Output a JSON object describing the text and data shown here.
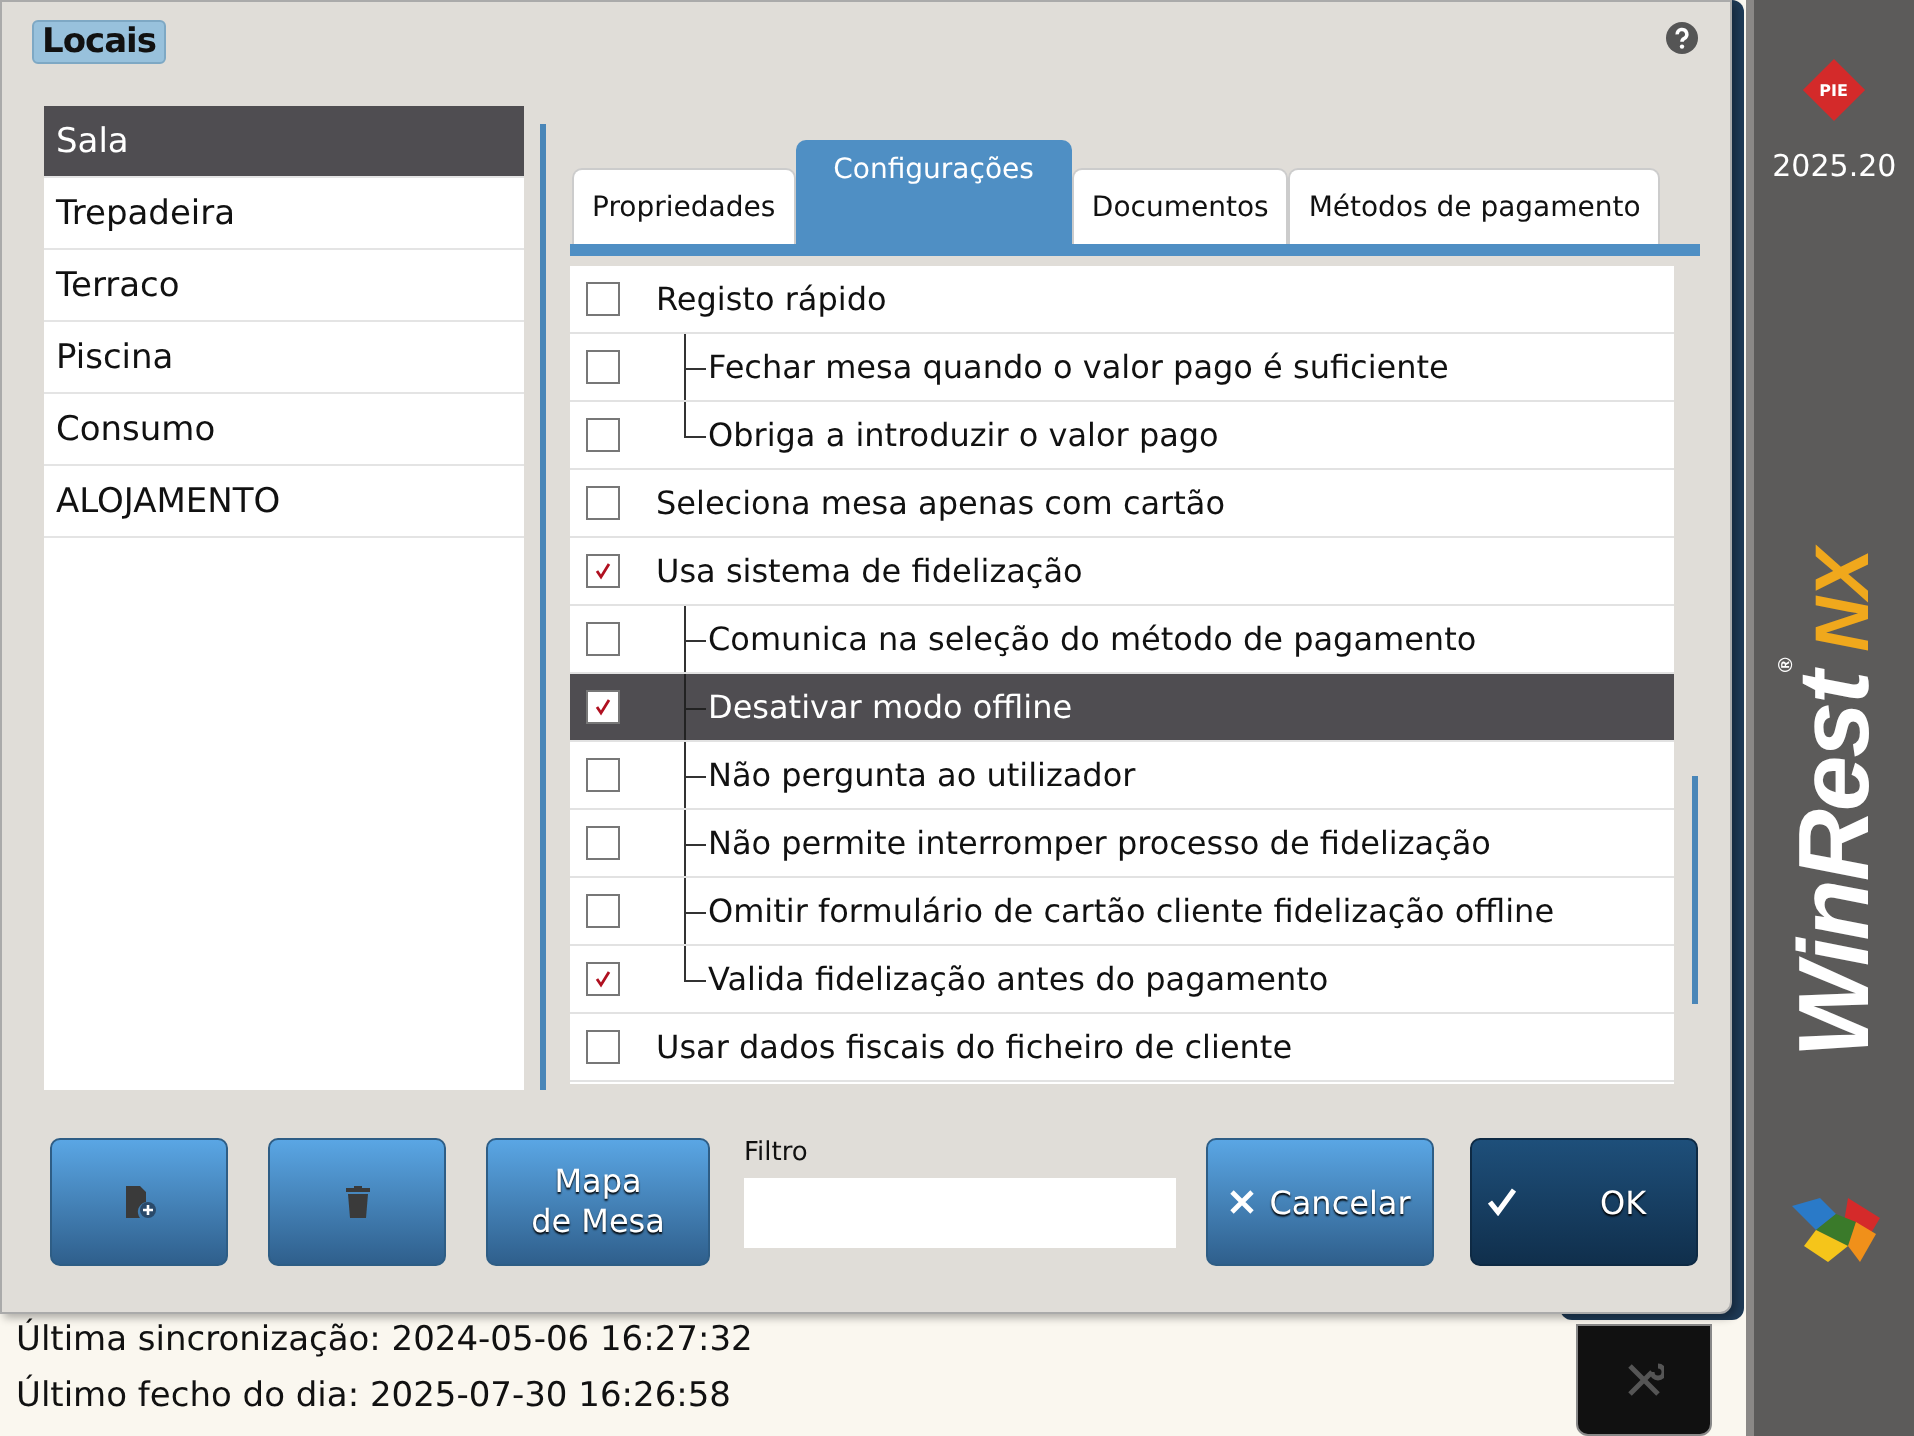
{
  "dialog": {
    "title": "Locais"
  },
  "locations": [
    {
      "label": "Sala",
      "selected": true
    },
    {
      "label": "Trepadeira",
      "selected": false
    },
    {
      "label": "Terraco",
      "selected": false
    },
    {
      "label": "Piscina",
      "selected": false
    },
    {
      "label": "Consumo",
      "selected": false
    },
    {
      "label": "ALOJAMENTO",
      "selected": false
    }
  ],
  "tabs": [
    {
      "label": "Propriedades",
      "selected": false
    },
    {
      "label": "Configurações",
      "selected": true
    },
    {
      "label": "Documentos",
      "selected": false
    },
    {
      "label": "Métodos de pagamento",
      "selected": false
    }
  ],
  "settings": [
    {
      "label": "Registo rápido",
      "checked": false,
      "selected": false,
      "children": [
        {
          "label": "Fechar mesa quando o valor pago é suficiente",
          "checked": false,
          "selected": false
        },
        {
          "label": "Obriga a introduzir o valor pago",
          "checked": false,
          "selected": false
        }
      ]
    },
    {
      "label": "Seleciona mesa apenas com cartão",
      "checked": false,
      "selected": false
    },
    {
      "label": "Usa sistema de fidelização",
      "checked": true,
      "selected": false,
      "children": [
        {
          "label": "Comunica na seleção do método de pagamento",
          "checked": false,
          "selected": false
        },
        {
          "label": "Desativar modo offline",
          "checked": true,
          "selected": true
        },
        {
          "label": "Não pergunta ao utilizador",
          "checked": false,
          "selected": false
        },
        {
          "label": "Não permite interromper processo de fidelização",
          "checked": false,
          "selected": false
        },
        {
          "label": "Omitir formulário de cartão cliente fidelização offline",
          "checked": false,
          "selected": false
        },
        {
          "label": "Valida fidelização antes do pagamento",
          "checked": true,
          "selected": false
        }
      ]
    },
    {
      "label": "Usar dados fiscais do ficheiro de cliente",
      "checked": false,
      "selected": false
    }
  ],
  "buttons": {
    "map": "Mapa\nde Mesa",
    "cancel": "Cancelar",
    "ok": "OK"
  },
  "filter": {
    "label": "Filtro"
  },
  "status": [
    "Última sincronização: 2024-05-06 16:27:32",
    "Último fecho do dia: 2025-07-30 16:26:58"
  ],
  "sidebar": {
    "logo": "PIE",
    "version": "2025.20",
    "brand": "WinRest",
    "brand_suffix": "NX",
    "registered": "®"
  }
}
